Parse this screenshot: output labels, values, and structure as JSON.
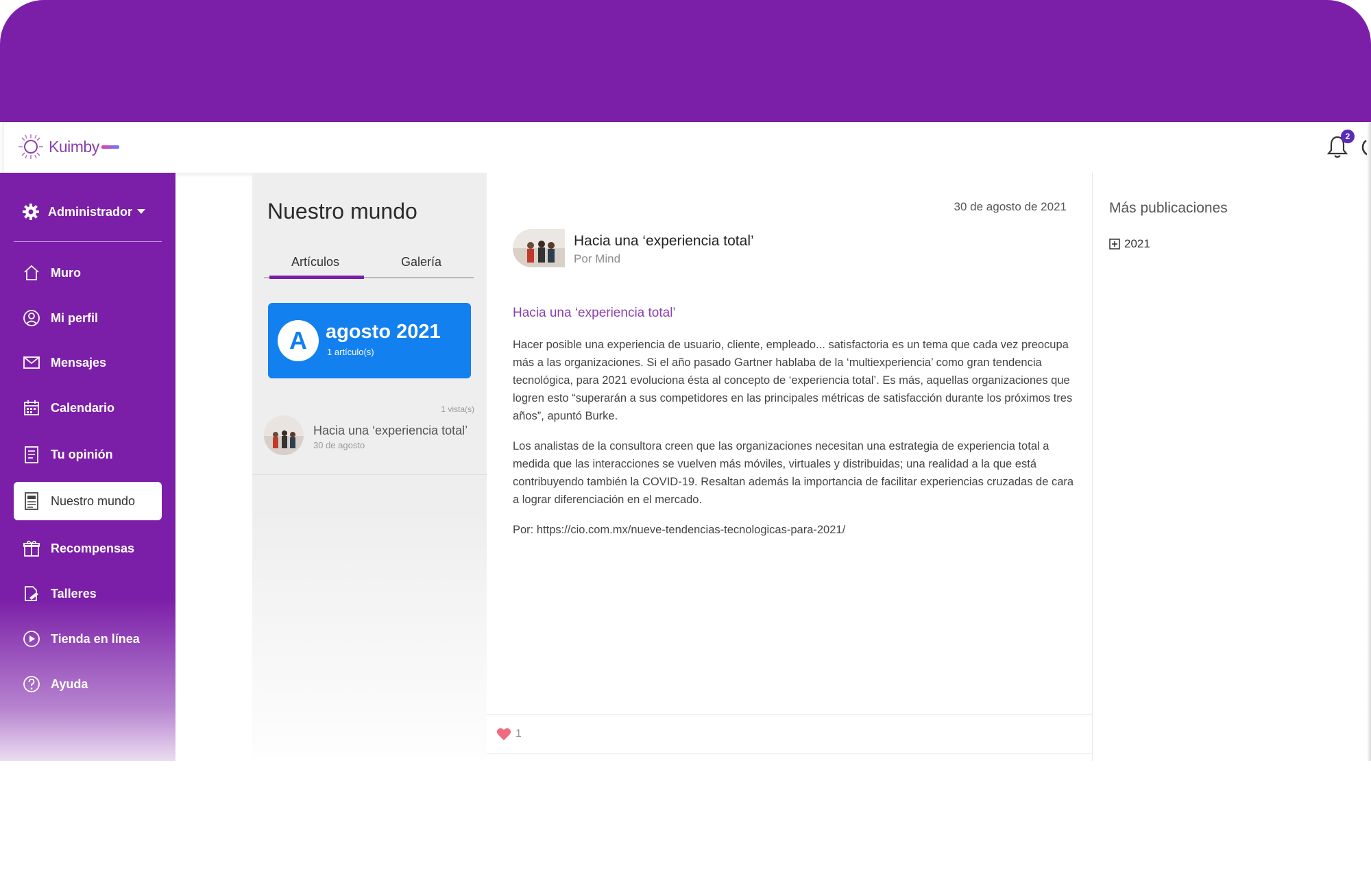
{
  "colors": {
    "brand_purple": "#7b1fa8",
    "accent_blue": "#1380f0",
    "heart": "#f06a80"
  },
  "header": {
    "logo_text": "Kuimby",
    "notification_count": "2",
    "icons": [
      "bell-icon",
      "power-icon"
    ]
  },
  "sidebar": {
    "admin_label": "Administrador",
    "items": [
      {
        "label": "Muro",
        "icon": "home-icon"
      },
      {
        "label": "Mi perfil",
        "icon": "user-icon"
      },
      {
        "label": "Mensajes",
        "icon": "envelope-icon"
      },
      {
        "label": "Calendario",
        "icon": "calendar-icon"
      },
      {
        "label": "Tu opinión",
        "icon": "checklist-icon"
      },
      {
        "label": "Nuestro mundo",
        "icon": "newspaper-icon",
        "active": true
      },
      {
        "label": "Recompensas",
        "icon": "gift-icon"
      },
      {
        "label": "Talleres",
        "icon": "workshop-icon"
      },
      {
        "label": "Tienda en línea",
        "icon": "play-circle-icon"
      },
      {
        "label": "Ayuda",
        "icon": "help-icon"
      }
    ]
  },
  "list": {
    "title": "Nuestro mundo",
    "tabs": [
      {
        "label": "Artículos",
        "active": true
      },
      {
        "label": "Galería",
        "active": false
      }
    ],
    "month_card": {
      "avatar_letter": "A",
      "month": "agosto 2021",
      "count": "1 artículo(s)"
    },
    "articles": [
      {
        "views": "1 vista(s)",
        "title": "Hacia una ‘experiencia total’",
        "date": "30 de agosto"
      }
    ]
  },
  "article": {
    "date": "30 de agosto de 2021",
    "title": "Hacia una ‘experiencia total’",
    "author": "Por Mind",
    "subtitle": "Hacia una ‘experiencia total’",
    "paragraphs": [
      "Hacer posible una experiencia de usuario, cliente, empleado... satisfactoria es un tema que cada vez preocupa más a las organizaciones. Si el año pasado Gartner hablaba de la ‘multiexperiencia’ como gran tendencia tecnológica, para 2021 evoluciona ésta al concepto de ‘experiencia total’. Es más, aquellas organizaciones que logren esto “superarán a sus competidores en las principales métricas de satisfacción durante los próximos tres años”, apuntó Burke.",
      "Los analistas de la consultora creen que las organizaciones necesitan una estrategia de experiencia total a medida que las interacciones se vuelven más móviles, virtuales y distribuidas; una realidad a la que está contribuyendo también la COVID-19. Resaltan además la importancia de facilitar experiencias cruzadas de cara a lograr diferenciación en el mercado."
    ],
    "source": "Por: https://cio.com.mx/nueve-tendencias-tecnologicas-para-2021/",
    "likes": "1"
  },
  "more": {
    "title": "Más publicaciones",
    "years": [
      "2021"
    ]
  }
}
